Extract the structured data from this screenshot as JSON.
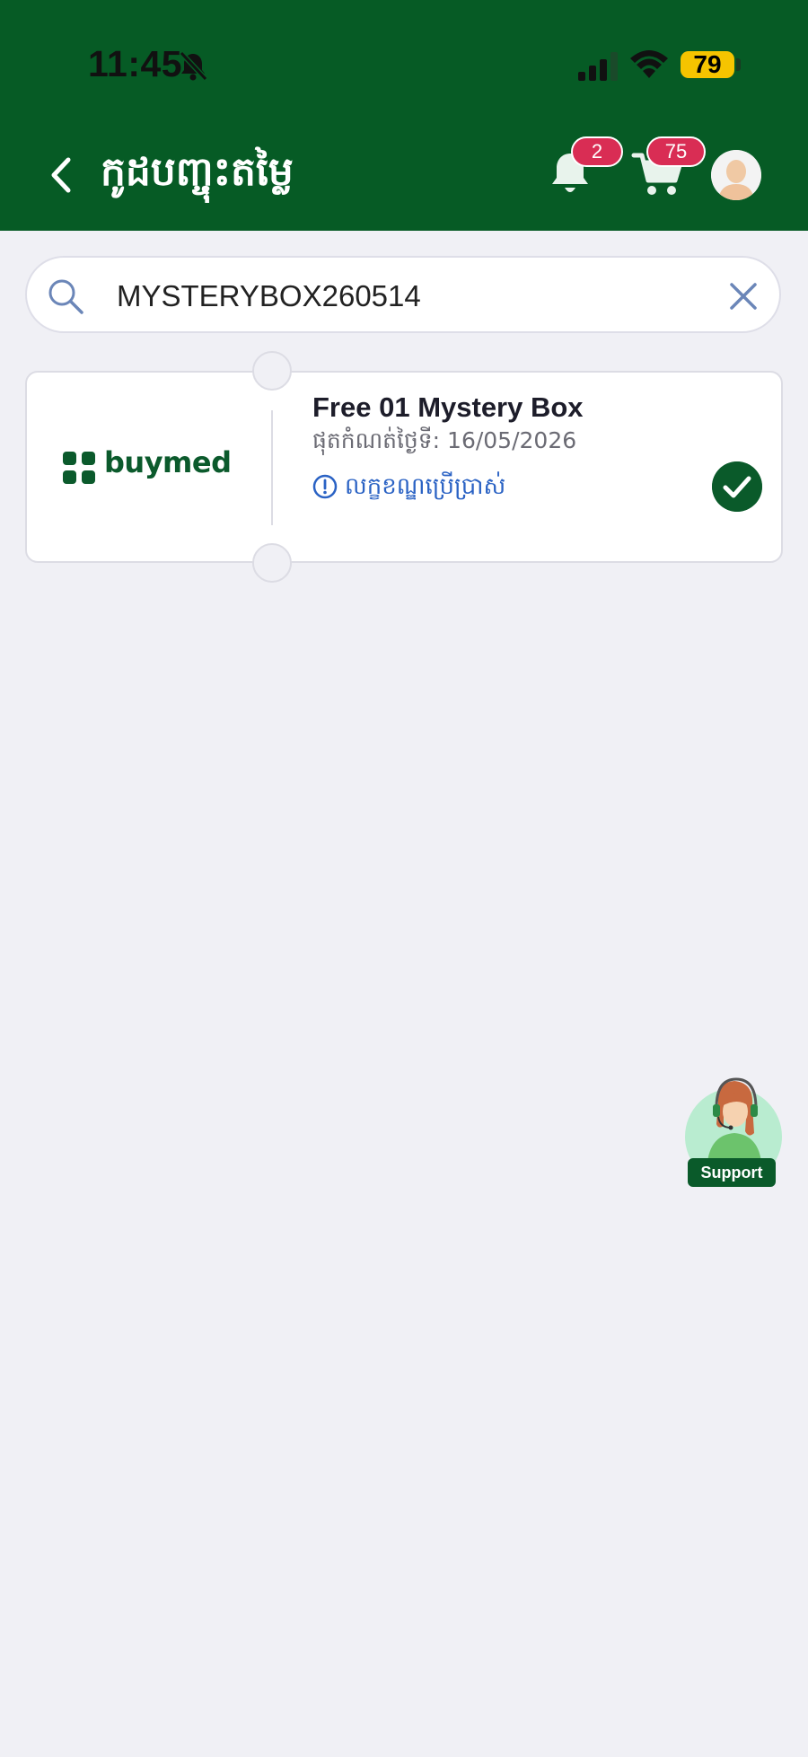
{
  "status_bar": {
    "time": "11:45",
    "battery": "79"
  },
  "header": {
    "title": "កូដបញ្ចុះតម្លៃ",
    "notification_count": "2",
    "cart_count": "75"
  },
  "search": {
    "value": "MYSTERYBOX260514"
  },
  "coupon": {
    "brand": "buymed",
    "title": "Free 01 Mystery Box",
    "expiry": "ផុតកំណត់ថ្ងៃទី: 16/05/2026",
    "conditions_label": "លក្ខខណ្ឌប្រើប្រាស់",
    "selected": true
  },
  "support": {
    "label": "Support"
  },
  "colors": {
    "header_bg": "#065b25",
    "brand_green": "#0a5a2a",
    "badge_red": "#d92d54",
    "link_blue": "#2a62c4",
    "page_bg": "#f0f0f5"
  }
}
